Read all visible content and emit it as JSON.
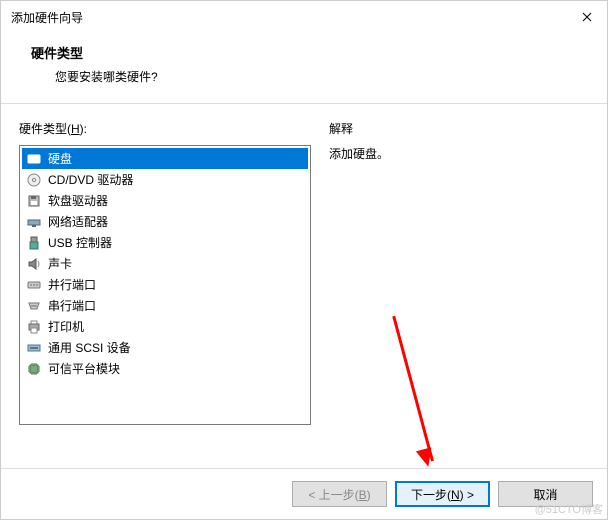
{
  "titlebar": {
    "title": "添加硬件向导"
  },
  "header": {
    "title": "硬件类型",
    "subtitle": "您要安装哪类硬件?"
  },
  "left": {
    "label_pre": "硬件类型(",
    "label_key": "H",
    "label_post": "):",
    "items": [
      {
        "label": "硬盘",
        "icon": "hdd-icon",
        "selected": true
      },
      {
        "label": "CD/DVD 驱动器",
        "icon": "cd-icon"
      },
      {
        "label": "软盘驱动器",
        "icon": "floppy-icon"
      },
      {
        "label": "网络适配器",
        "icon": "network-icon"
      },
      {
        "label": "USB 控制器",
        "icon": "usb-icon"
      },
      {
        "label": "声卡",
        "icon": "sound-icon"
      },
      {
        "label": "并行端口",
        "icon": "parallel-icon"
      },
      {
        "label": "串行端口",
        "icon": "serial-icon"
      },
      {
        "label": "打印机",
        "icon": "printer-icon"
      },
      {
        "label": "通用 SCSI 设备",
        "icon": "scsi-icon"
      },
      {
        "label": "可信平台模块",
        "icon": "tpm-icon"
      }
    ]
  },
  "right": {
    "label": "解释",
    "text": "添加硬盘。"
  },
  "buttons": {
    "back_pre": "< 上一步(",
    "back_key": "B",
    "back_post": ")",
    "next_pre": "下一步(",
    "next_key": "N",
    "next_post": ") >",
    "cancel": "取消"
  },
  "watermark": "@51CTO博客"
}
